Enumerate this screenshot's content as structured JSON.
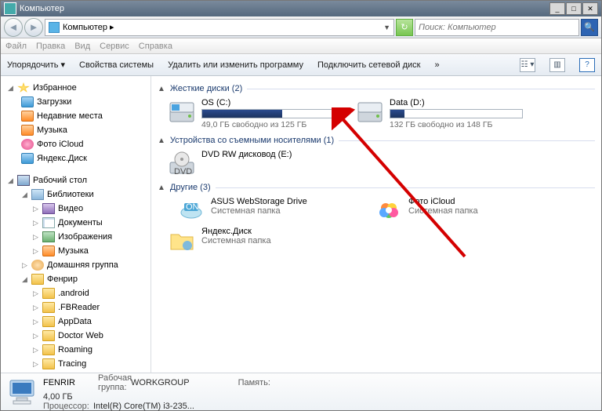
{
  "window": {
    "title": "Компьютер"
  },
  "address": {
    "breadcrumb": "Компьютер ▸"
  },
  "search": {
    "placeholder": "Поиск: Компьютер"
  },
  "menu": {
    "file": "Файл",
    "edit": "Правка",
    "view": "Вид",
    "service": "Сервис",
    "help": "Справка"
  },
  "toolbar": {
    "organize": "Упорядочить ▾",
    "sys_props": "Свойства системы",
    "uninstall": "Удалить или изменить программу",
    "map_drive": "Подключить сетевой диск",
    "more": "»"
  },
  "sidebar": {
    "favorites": "Избранное",
    "downloads": "Загрузки",
    "recent": "Недавние места",
    "music1": "Музыка",
    "photo_icloud": "Фото iCloud",
    "yadisk": "Яндекс.Диск",
    "desktop": "Рабочий стол",
    "libraries": "Библиотеки",
    "video": "Видео",
    "documents": "Документы",
    "pictures": "Изображения",
    "music2": "Музыка",
    "homegroup": "Домашняя группа",
    "fenrir": "Фенрир",
    "android": ".android",
    "fbreader": ".FBReader",
    "appdata": "AppData",
    "doctorweb": "Doctor Web",
    "roaming": "Roaming",
    "tracing": "Tracing"
  },
  "groups": {
    "hdd": "Жесткие диски (2)",
    "removable": "Устройства со съемными носителями (1)",
    "other": "Другие (3)"
  },
  "drives": {
    "c": {
      "name": "OS (C:)",
      "sub": "49,0 ГБ свободно из 125 ГБ",
      "fill_pct": 61
    },
    "d": {
      "name": "Data (D:)",
      "sub": "132 ГБ свободно из 148 ГБ",
      "fill_pct": 11
    }
  },
  "dvd": {
    "name": "DVD RW дисковод (E:)"
  },
  "others": {
    "asus": {
      "name": "ASUS WebStorage Drive",
      "sub": "Системная папка"
    },
    "icloud": {
      "name": "Фото iCloud",
      "sub": "Системная папка"
    },
    "yadisk": {
      "name": "Яндекс.Диск",
      "sub": "Системная папка"
    }
  },
  "details": {
    "name": "FENRIR",
    "wg_label": "Рабочая группа:",
    "wg_val": "WORKGROUP",
    "mem_label": "Память:",
    "mem_val": "4,00 ГБ",
    "cpu_label": "Процессор:",
    "cpu_val": "Intel(R) Core(TM) i3-235..."
  }
}
